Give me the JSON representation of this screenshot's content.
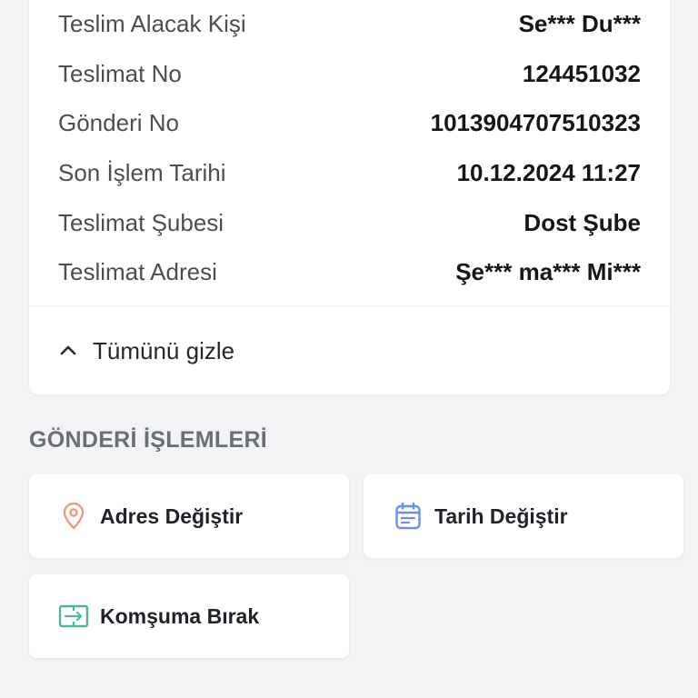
{
  "details": {
    "rows": [
      {
        "label": "Teslim Alacak Kişi",
        "value": "Se*** Du***"
      },
      {
        "label": "Teslimat No",
        "value": "124451032"
      },
      {
        "label": "Gönderi No",
        "value": "1013904707510323"
      },
      {
        "label": "Son İşlem Tarihi",
        "value": "10.12.2024 11:27"
      },
      {
        "label": "Teslimat Şubesi",
        "value": "Dost Şube"
      },
      {
        "label": "Teslimat Adresi",
        "value": "Şe*** ma*** Mi***"
      }
    ],
    "collapse_label": "Tümünü gizle",
    "collapse_icon": "chevron-up-icon"
  },
  "actions_section": {
    "title": "GÖNDERİ İŞLEMLERİ",
    "items": [
      {
        "label": "Adres Değiştir",
        "icon": "location-pin-icon",
        "icon_color": "#f0997a"
      },
      {
        "label": "Tarih Değiştir",
        "icon": "calendar-icon",
        "icon_color": "#6b8ff0"
      },
      {
        "label": "Komşuma Bırak",
        "icon": "neighbor-transfer-icon",
        "icon_color": "#4fb789"
      }
    ]
  }
}
